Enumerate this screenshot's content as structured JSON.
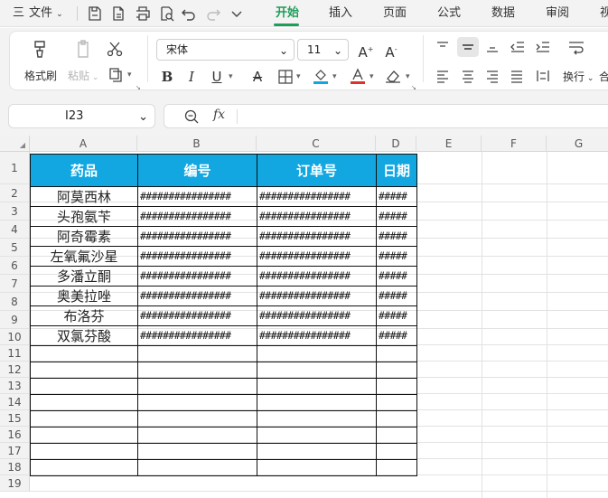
{
  "menu": {
    "file_label": "文件",
    "hamburger": "三",
    "tabs": [
      {
        "label": "开始",
        "active": true
      },
      {
        "label": "插入",
        "active": false
      },
      {
        "label": "页面",
        "active": false
      },
      {
        "label": "公式",
        "active": false
      },
      {
        "label": "数据",
        "active": false
      },
      {
        "label": "审阅",
        "active": false
      },
      {
        "label": "视",
        "active": false
      }
    ],
    "accent_color": "#1e9e5a"
  },
  "ribbon": {
    "format_painter_label": "格式刷",
    "paste_label": "粘贴",
    "font_name": "宋体",
    "font_size": "11",
    "wrap_label": "换行",
    "partial_label": "合"
  },
  "formula_bar": {
    "cell_ref": "I23",
    "formula": ""
  },
  "sheet": {
    "columns": [
      "A",
      "B",
      "C",
      "D",
      "E",
      "F",
      "G"
    ],
    "rows": [
      "1",
      "2",
      "3",
      "4",
      "5",
      "6",
      "7",
      "8",
      "9",
      "10",
      "11",
      "12",
      "13",
      "14",
      "15",
      "16",
      "17",
      "18",
      "19"
    ],
    "header_color": "#12a7e0",
    "table": {
      "headers": [
        "药品",
        "编号",
        "订单号",
        "日期"
      ],
      "rows": [
        [
          "阿莫西林",
          "################",
          "################",
          "#####"
        ],
        [
          "头孢氨苄",
          "################",
          "################",
          "#####"
        ],
        [
          "阿奇霉素",
          "################",
          "################",
          "#####"
        ],
        [
          "左氧氟沙星",
          "################",
          "################",
          "#####"
        ],
        [
          "多潘立酮",
          "################",
          "################",
          "#####"
        ],
        [
          "奥美拉唑",
          "################",
          "################",
          "#####"
        ],
        [
          "布洛芬",
          "################",
          "################",
          "#####"
        ],
        [
          "双氯芬酸",
          "################",
          "################",
          "#####"
        ],
        [
          "",
          "",
          "",
          ""
        ],
        [
          "",
          "",
          "",
          ""
        ],
        [
          "",
          "",
          "",
          ""
        ],
        [
          "",
          "",
          "",
          ""
        ],
        [
          "",
          "",
          "",
          ""
        ],
        [
          "",
          "",
          "",
          ""
        ],
        [
          "",
          "",
          "",
          ""
        ],
        [
          "",
          "",
          "",
          ""
        ]
      ]
    }
  }
}
